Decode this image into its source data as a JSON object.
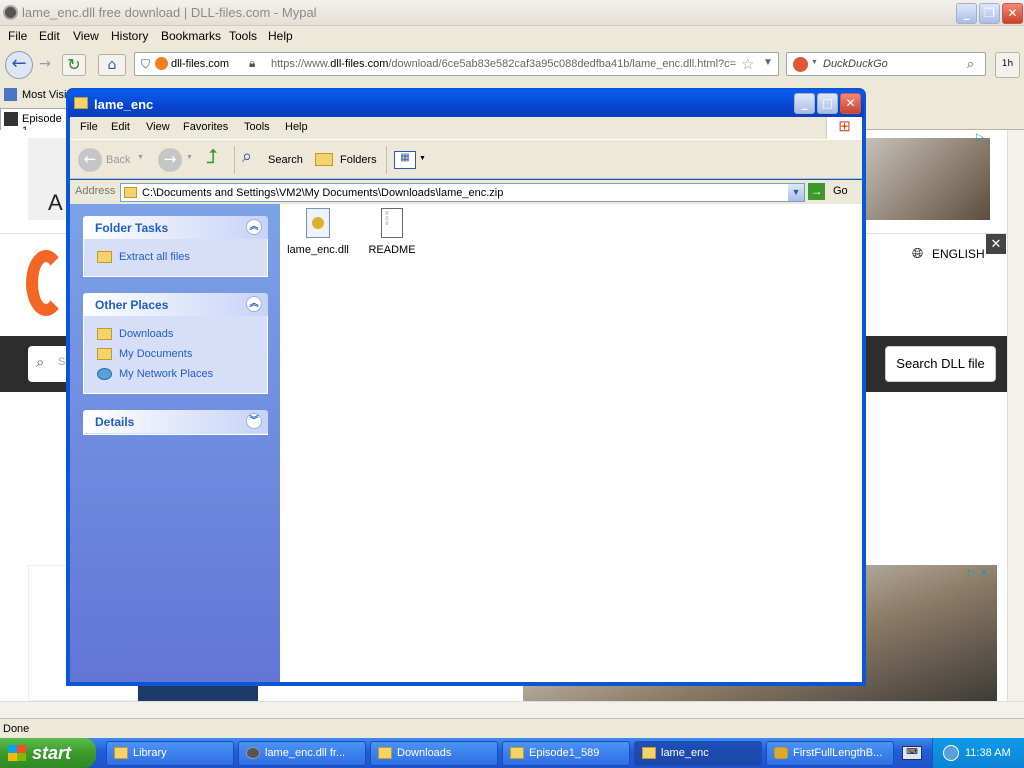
{
  "browser": {
    "title": "lame_enc.dll free download | DLL-files.com - Mypal",
    "menu": [
      "File",
      "Edit",
      "View",
      "History",
      "Bookmarks",
      "Tools",
      "Help"
    ],
    "site": "dll-files.com",
    "url_prefix": "https://www.",
    "url_domain": "dll-files.com",
    "url_rest": "/download/6ce5ab83e582caf3a95c088dedfba41b/lame_enc.dll.html?c=",
    "search_placeholder": "DuckDuckGo",
    "bookmark": "Most Visit",
    "tab": "Episode 1",
    "status": "Done",
    "badge": "1h"
  },
  "webpage": {
    "language": "ENGLISH",
    "search_button": "Search DLL file",
    "search_placeholder": "S",
    "ad_label": "A"
  },
  "explorer": {
    "title": "lame_enc",
    "menu": [
      "File",
      "Edit",
      "View",
      "Favorites",
      "Tools",
      "Help"
    ],
    "toolbar": {
      "back": "Back",
      "search": "Search",
      "folders": "Folders"
    },
    "address_label": "Address",
    "address": "C:\\Documents and Settings\\VM2\\My Documents\\Downloads\\lame_enc.zip",
    "go": "Go",
    "folder_tasks": {
      "title": "Folder Tasks",
      "items": [
        "Extract all files"
      ]
    },
    "other_places": {
      "title": "Other Places",
      "items": [
        "Downloads",
        "My Documents",
        "My Network Places"
      ]
    },
    "details": {
      "title": "Details"
    },
    "files": [
      "lame_enc.dll",
      "README"
    ]
  },
  "taskbar": {
    "start": "start",
    "tasks": [
      "Library",
      "lame_enc.dll fr...",
      "Downloads",
      "Episode1_589",
      "lame_enc",
      "FirstFullLengthB..."
    ],
    "clock": "11:38 AM"
  }
}
